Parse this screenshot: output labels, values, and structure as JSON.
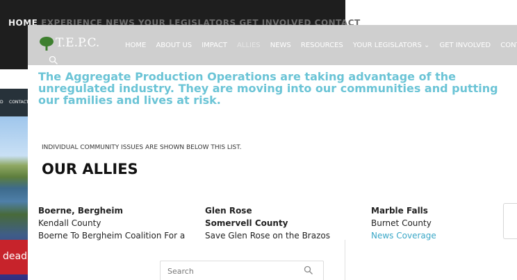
{
  "back_window": {
    "nav_first": "HOME",
    "nav_blurred": "EXPERIENCE NEWS YOUR LEGISLATORS GET INVOLVED CONTACT"
  },
  "mid_window": {
    "nav_items": [
      "D",
      "CONTACT US"
    ],
    "banner_text": "dead. Thank you for"
  },
  "site": {
    "logo_text": "T.E.P.C.",
    "nav": [
      "HOME",
      "ABOUT US",
      "IMPACT",
      "ALLIES",
      "NEWS",
      "RESOURCES",
      "YOUR LEGISLATORS ⌄",
      "GET INVOLVED",
      "CONTACT"
    ],
    "active_nav": "ALLIES",
    "headline": [
      "The Aggregate Production Operations are taking advantage of the",
      "unregulated industry. They are moving into our communities and putting",
      "our families and lives at risk."
    ],
    "issues_note": "INDIVIDUAL COMMUNITY ISSUES ARE SHOWN BELOW THIS LIST.",
    "allies_title": "OUR ALLIES",
    "allies": [
      {
        "line1": "Boerne, Bergheim",
        "line2": "Kendall County",
        "line3": "Boerne To Bergheim Coalition For a"
      },
      {
        "line1": "Glen Rose",
        "line2": "Somervell County",
        "line3": "Save Glen Rose on the Brazos"
      },
      {
        "line1": "Marble Falls",
        "line2": "Burnet County",
        "line3": "News Coverage"
      }
    ],
    "search_placeholder": "Search"
  },
  "colors": {
    "headline": "#6bc4d6",
    "link": "#3aa7c7",
    "banner": "#c7232b",
    "header_band": "#cfcfcf",
    "tree_logo": "#3d7f2e"
  }
}
